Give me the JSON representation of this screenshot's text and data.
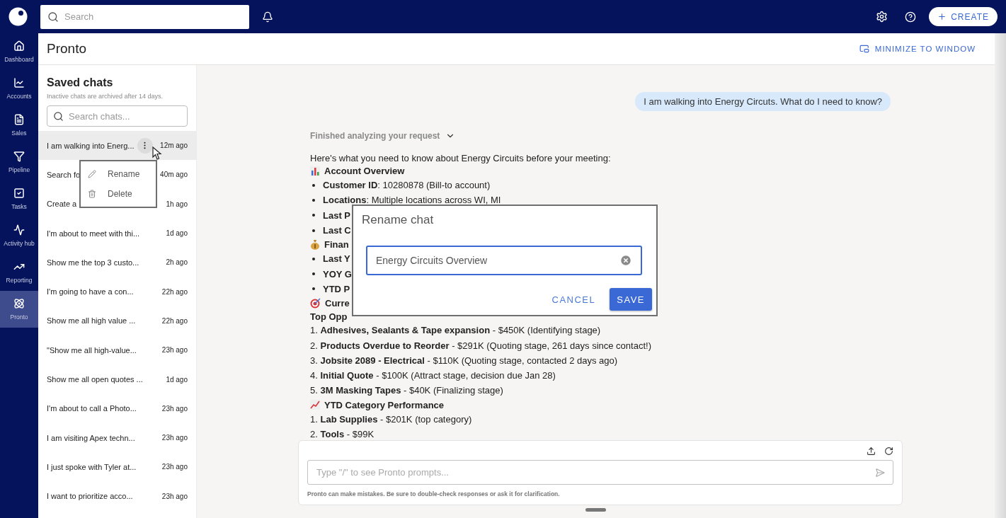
{
  "topbar": {
    "search_placeholder": "Search",
    "create_label": "CREATE"
  },
  "rail": [
    {
      "label": "Dashboard",
      "selected": false
    },
    {
      "label": "Accounts",
      "selected": false
    },
    {
      "label": "Sales",
      "selected": false
    },
    {
      "label": "Pipeline",
      "selected": false
    },
    {
      "label": "Tasks",
      "selected": false
    },
    {
      "label": "Activity hub",
      "selected": false
    },
    {
      "label": "Reporting",
      "selected": false
    },
    {
      "label": "Pronto",
      "selected": true
    }
  ],
  "page": {
    "title": "Pronto",
    "minimize_label": "MINIMIZE TO WINDOW"
  },
  "saved_chats": {
    "title": "Saved chats",
    "note": "Inactive chats are archived after 14 days.",
    "search_placeholder": "Search chats...",
    "items": [
      {
        "title": "I am walking into Energ...",
        "time": "12m ago",
        "selected": true
      },
      {
        "title": "Search fo",
        "time": "40m ago",
        "selected": false
      },
      {
        "title": "Create a",
        "time": "1h ago",
        "selected": false
      },
      {
        "title": "I'm about to meet with thi...",
        "time": "1d ago",
        "selected": false
      },
      {
        "title": "Show me the top 3 custo...",
        "time": "2h ago",
        "selected": false
      },
      {
        "title": "I'm going to have a con...",
        "time": "22h ago",
        "selected": false
      },
      {
        "title": "Show me all high value ...",
        "time": "22h ago",
        "selected": false
      },
      {
        "title": "\"Show me all high-value...",
        "time": "23h ago",
        "selected": false
      },
      {
        "title": "Show me all open quotes ...",
        "time": "1d ago",
        "selected": false
      },
      {
        "title": "I'm about to call a Photo...",
        "time": "23h ago",
        "selected": false
      },
      {
        "title": "I am visiting Apex techn...",
        "time": "23h ago",
        "selected": false
      },
      {
        "title": "I just spoke with Tyler at...",
        "time": "23h ago",
        "selected": false
      },
      {
        "title": "I want to prioritize acco...",
        "time": "23h ago",
        "selected": false
      }
    ]
  },
  "context_menu": [
    {
      "label": "Rename",
      "kind": "rename"
    },
    {
      "label": "Delete",
      "kind": "delete"
    }
  ],
  "conversation": {
    "user_message": "I am walking into Energy Circuts. What do I need to know?",
    "status": "Finished analyzing your request",
    "response": [
      {
        "kind": "para",
        "text": "Here's what you need to know about Energy Circuits before your meeting:"
      },
      {
        "kind": "chartheading",
        "text": "Account Overview"
      },
      {
        "kind": "bullet",
        "text": "**Customer ID**: 10280878 (Bill-to account)"
      },
      {
        "kind": "bullet",
        "text": "**Locations**: Multiple locations across WI, MI"
      },
      {
        "kind": "bullet",
        "bold": true,
        "text": "Last P"
      },
      {
        "kind": "bullet",
        "bold": true,
        "text": "Last C"
      },
      {
        "kind": "moneyheading",
        "text": "Finan"
      },
      {
        "kind": "bullet",
        "bold": true,
        "text": "Last Y"
      },
      {
        "kind": "bullet",
        "bold": true,
        "text": "YOY G"
      },
      {
        "kind": "bullet",
        "bold": true,
        "text": "YTD P"
      },
      {
        "kind": "targetheading",
        "text": "Curre"
      },
      {
        "kind": "line",
        "bold": true,
        "text": "Top Opp"
      },
      {
        "kind": "line",
        "text": "1. **Adhesives, Sealants & Tape expansion** - $450K (Identifying stage)"
      },
      {
        "kind": "line",
        "text": "2. **Products Overdue to Reorder** - $291K (Quoting stage, 261 days since contact!)"
      },
      {
        "kind": "line",
        "text": "3. **Jobsite 2089 - Electrical** - $110K (Quoting stage, contacted 2 days ago)"
      },
      {
        "kind": "line",
        "text": "4. **Initial Quote** - $100K (Attract stage, decision due Jan 28)"
      },
      {
        "kind": "line",
        "text": "5. **3M Masking Tapes** - $40K (Finalizing stage)"
      },
      {
        "kind": "trendheading",
        "text": "YTD Category Performance"
      },
      {
        "kind": "line",
        "text": "1. **Lab Supplies** - $201K (top category)"
      },
      {
        "kind": "line",
        "text": "2. **Tools** - $99K"
      }
    ],
    "composer": {
      "placeholder": "Type \"/\" to see Pronto prompts...",
      "disclaimer": "Pronto can make mistakes. Be sure to double-check responses or ask it for clarification."
    }
  },
  "dialog": {
    "title": "Rename chat",
    "value": "Energy Circuits Overview",
    "cancel_label": "CANCEL",
    "save_label": "SAVE"
  }
}
